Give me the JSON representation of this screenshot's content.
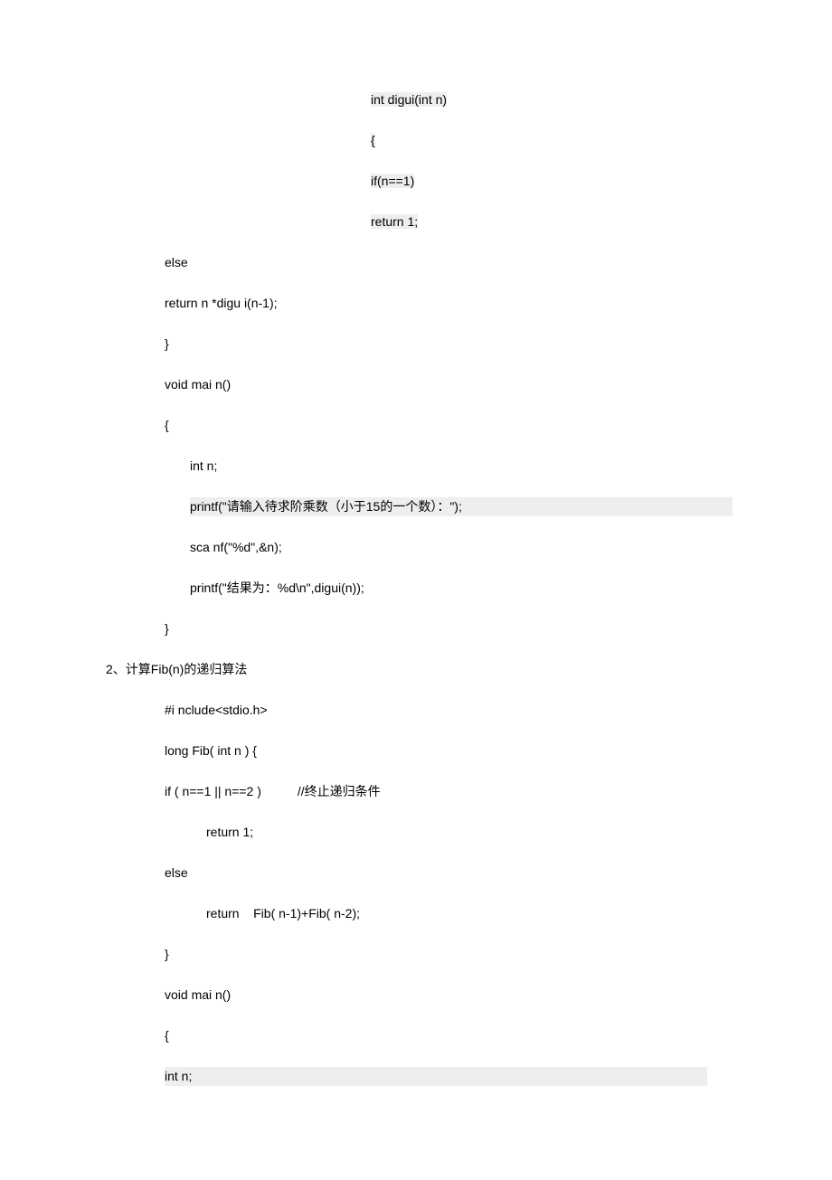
{
  "block1": {
    "l1": "int digui(int n)",
    "l2": "{",
    "l3": "if(n==1)",
    "l4": "return 1;",
    "l5": "else",
    "l6": "return n *digu i(n-1);",
    "l7": "}",
    "l8": "void mai n()",
    "l9": "{",
    "l10": "int n;",
    "l11": "printf(\"请输入待求阶乘数（小于15的一个数）：\");",
    "l12": "sca nf(\"%d\",&n);",
    "l13": "printf(\"结果为：%d\\n\",digui(n));",
    "l14": "}"
  },
  "heading": "2、计算Fib(n)的递归算法",
  "block2": {
    "l1": "#i nclude<stdio.h>",
    "l2": "long Fib( int n ) {",
    "l3a": "if ( n==1 || n==2 )",
    "l3b": "//终止递归条件",
    "l4": "return 1;",
    "l5": "else",
    "l6": "return    Fib( n-1)+Fib( n-2);",
    "l7": "}",
    "l8": "void mai n()",
    "l9": "{",
    "l10": "int n;"
  }
}
